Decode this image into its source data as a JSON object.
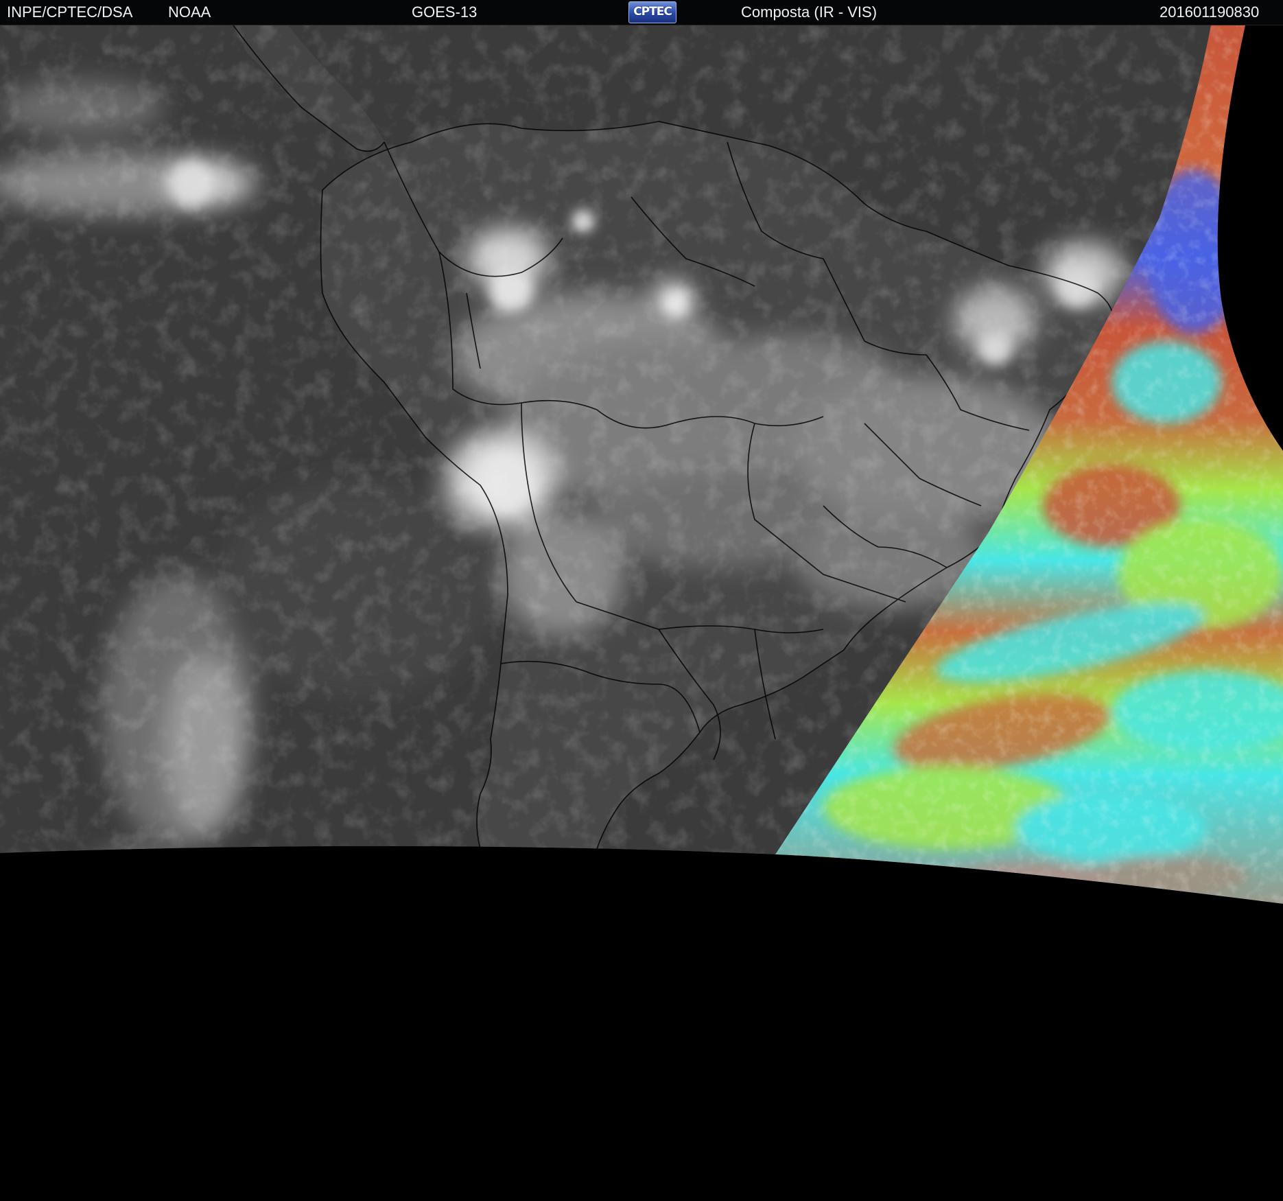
{
  "header": {
    "agency": "INPE/CPTEC/DSA",
    "provider": "NOAA",
    "satellite": "GOES-13",
    "logo_text": "CPTEC",
    "product": "Composta (IR - VIS)",
    "timestamp": "201601190830"
  },
  "map": {
    "region": "South America",
    "ir_layer": "grayscale",
    "vis_layer": "false-color",
    "colors": {
      "ocean_ir": "#3a3a3a",
      "land_ir": "#4a4a4a",
      "cloud_ir": "#d8d8d8",
      "border": "#000000",
      "vis_red": "#c8553a",
      "vis_green": "#a6e64a",
      "vis_cyan": "#48e6e6",
      "vis_blue": "#4a64e6",
      "nodata": "#000000"
    }
  }
}
